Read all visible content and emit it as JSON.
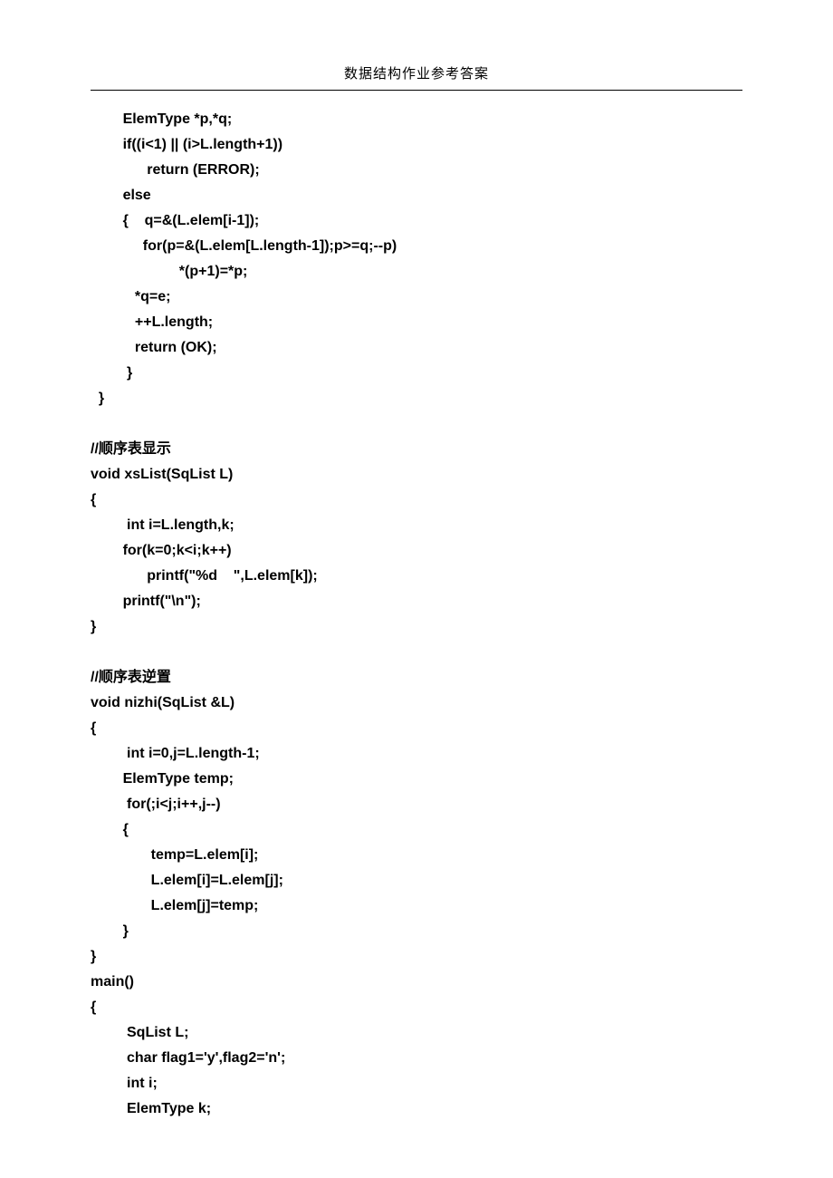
{
  "header": "数据结构作业参考答案",
  "code_lines": [
    "        ElemType *p,*q;",
    "        if((i<1) || (i>L.length+1))",
    "              return (ERROR);",
    "        else",
    "        {    q=&(L.elem[i-1]);",
    "             for(p=&(L.elem[L.length-1]);p>=q;--p)",
    "                      *(p+1)=*p;",
    "           *q=e;",
    "           ++L.length;",
    "           return (OK);",
    "         }",
    "  }",
    "",
    "//顺序表显示",
    "void xsList(SqList L)",
    "{",
    "         int i=L.length,k;",
    "        for(k=0;k<i;k++)",
    "              printf(\"%d    \",L.elem[k]);",
    "        printf(\"\\n\");",
    "}",
    "",
    "//顺序表逆置",
    "void nizhi(SqList &L)",
    "{",
    "         int i=0,j=L.length-1;",
    "        ElemType temp;",
    "         for(;i<j;i++,j--)",
    "        {",
    "               temp=L.elem[i];",
    "               L.elem[i]=L.elem[j];",
    "               L.elem[j]=temp;",
    "        }",
    "}",
    "main()",
    "{",
    "         SqList L;",
    "         char flag1='y',flag2='n';",
    "         int i;",
    "         ElemType k;"
  ]
}
